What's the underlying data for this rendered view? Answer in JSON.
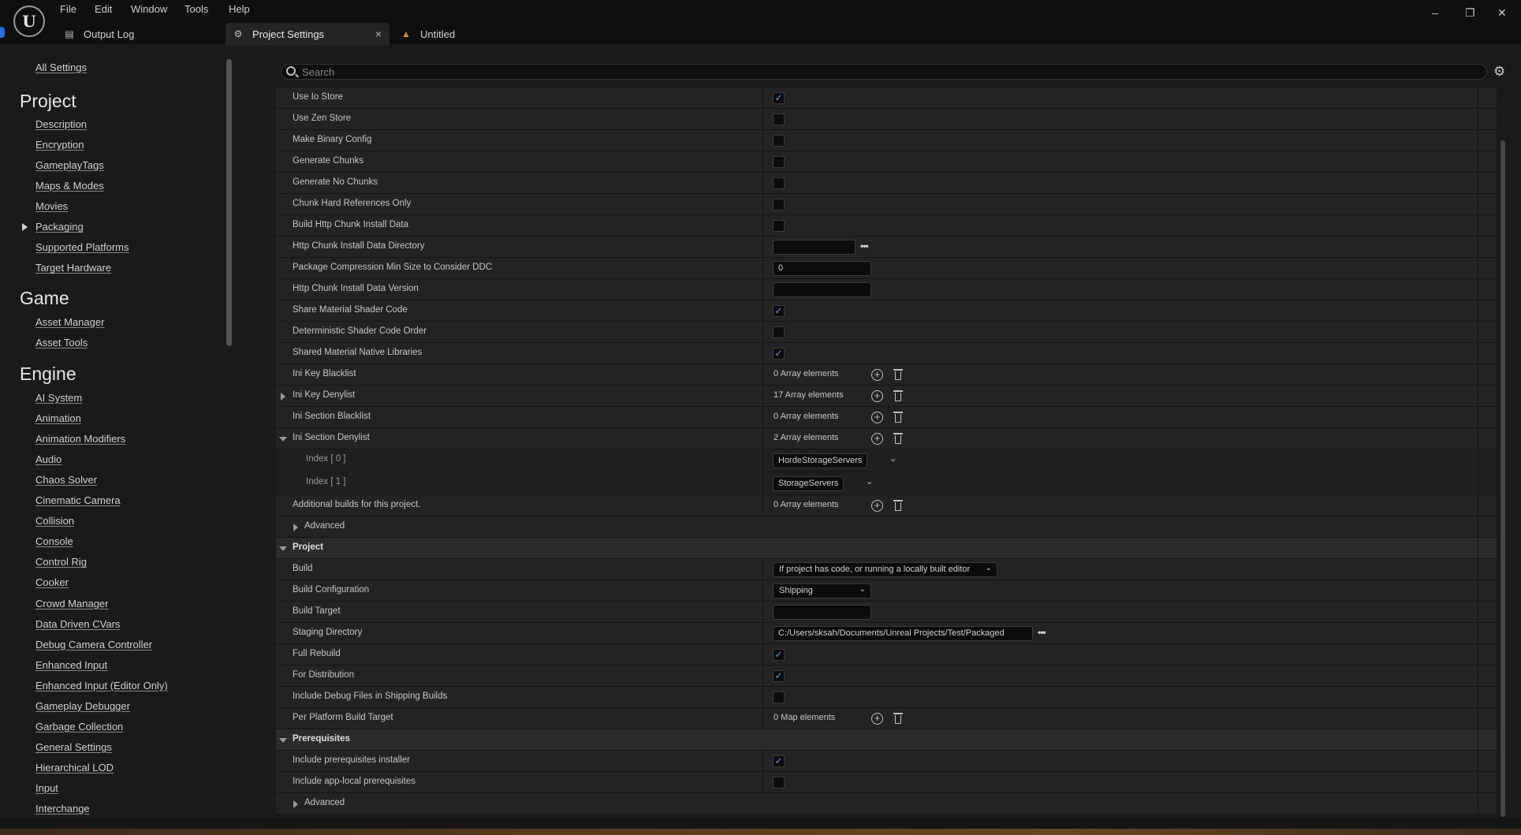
{
  "window": {
    "menu": [
      "File",
      "Edit",
      "Window",
      "Tools",
      "Help"
    ],
    "logo": "unreal-logo",
    "tabs": [
      {
        "label": "Output Log",
        "icon": "output-log-icon"
      },
      {
        "label": "Project Settings",
        "icon": "project-settings-icon",
        "close": "×"
      },
      {
        "label": "Untitled",
        "icon": "level-icon"
      }
    ],
    "controls": [
      "–",
      "❐",
      "✕"
    ]
  },
  "sidebar": {
    "all_settings": "All Settings",
    "sections": [
      {
        "heading": "Project",
        "items": [
          "Description",
          "Encryption",
          "GameplayTags",
          "Maps & Modes",
          "Movies",
          "Packaging",
          "Supported Platforms",
          "Target Hardware"
        ]
      },
      {
        "heading": "Game",
        "items": [
          "Asset Manager",
          "Asset Tools"
        ]
      },
      {
        "heading": "Engine",
        "items": [
          "AI System",
          "Animation",
          "Animation Modifiers",
          "Audio",
          "Chaos Solver",
          "Cinematic Camera",
          "Collision",
          "Console",
          "Control Rig",
          "Cooker",
          "Crowd Manager",
          "Data Driven CVars",
          "Debug Camera Controller",
          "Enhanced Input",
          "Enhanced Input (Editor Only)",
          "Gameplay Debugger",
          "Garbage Collection",
          "General Settings",
          "Hierarchical LOD",
          "Input",
          "Interchange"
        ]
      }
    ]
  },
  "search": {
    "placeholder": "Search"
  },
  "settings": {
    "rows": [
      {
        "label": "Use Io Store",
        "type": "check",
        "value": true
      },
      {
        "label": "Use Zen Store",
        "type": "check",
        "value": false
      },
      {
        "label": "Make Binary Config",
        "type": "check",
        "value": false
      },
      {
        "label": "Generate Chunks",
        "type": "check",
        "value": false
      },
      {
        "label": "Generate No Chunks",
        "type": "check",
        "value": false
      },
      {
        "label": "Chunk Hard References Only",
        "type": "check",
        "value": false
      },
      {
        "label": "Build Http Chunk Install Data",
        "type": "check",
        "value": false
      },
      {
        "label": "Http Chunk Install Data Directory",
        "type": "path",
        "value": ""
      },
      {
        "label": "Package Compression Min Size to Consider DDC",
        "type": "text",
        "value": "0"
      },
      {
        "label": "Http Chunk Install Data Version",
        "type": "text",
        "value": ""
      },
      {
        "label": "Share Material Shader Code",
        "type": "check",
        "value": true
      },
      {
        "label": "Deterministic Shader Code Order",
        "type": "check",
        "value": false
      },
      {
        "label": "Shared Material Native Libraries",
        "type": "check",
        "value": true
      },
      {
        "label": "Ini Key Blacklist",
        "type": "array",
        "value": "0 Array elements"
      },
      {
        "label": "Ini Key Denylist",
        "type": "array",
        "value": "17 Array elements",
        "expander": "collapsed"
      },
      {
        "label": "Ini Section Blacklist",
        "type": "array",
        "value": "0 Array elements"
      },
      {
        "label": "Ini Section Denylist",
        "type": "array",
        "value": "2 Array elements",
        "expander": "expanded"
      },
      {
        "label": "Index [ 0 ]",
        "type": "index",
        "value": "HordeStorageServers"
      },
      {
        "label": "Index [ 1 ]",
        "type": "index",
        "value": "StorageServers"
      },
      {
        "label": "Additional builds for this project.",
        "type": "array",
        "value": "0 Array elements"
      },
      {
        "label": "Advanced",
        "type": "advanced"
      },
      {
        "label": "Project",
        "type": "category"
      },
      {
        "label": "Build",
        "type": "combo",
        "value": "If project has code, or running a locally built editor"
      },
      {
        "label": "Build Configuration",
        "type": "combo",
        "value": "Shipping"
      },
      {
        "label": "Build Target",
        "type": "text",
        "value": ""
      },
      {
        "label": "Staging Directory",
        "type": "path",
        "value": "C:/Users/sksah/Documents/Unreal Projects/Test/Packaged"
      },
      {
        "label": "Full Rebuild",
        "type": "check",
        "value": true
      },
      {
        "label": "For Distribution",
        "type": "check",
        "value": true
      },
      {
        "label": "Include Debug Files in Shipping Builds",
        "type": "check",
        "value": false
      },
      {
        "label": "Per Platform Build Target",
        "type": "array",
        "value": "0 Map elements"
      },
      {
        "label": "Prerequisites",
        "type": "category"
      },
      {
        "label": "Include prerequisites installer",
        "type": "check",
        "value": true
      },
      {
        "label": "Include app-local prerequisites",
        "type": "check",
        "value": false
      },
      {
        "label": "Advanced",
        "type": "advanced"
      }
    ]
  },
  "icons": {
    "check": "✓",
    "dots": "•••",
    "chevron": "⌄",
    "plus": "+",
    "gear": "⚙"
  }
}
